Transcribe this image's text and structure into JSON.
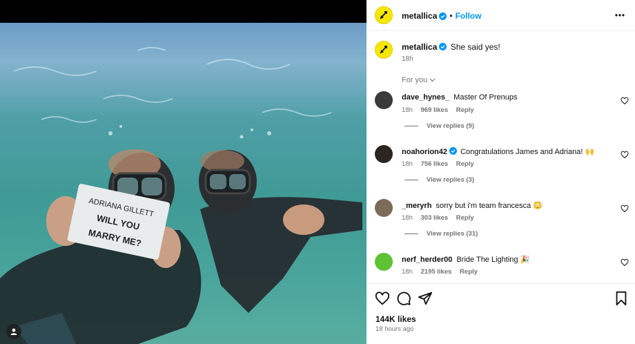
{
  "post": {
    "username": "metallica",
    "follow_label": "Follow",
    "caption": "She said yes!",
    "caption_time": "18h",
    "sort_label": "For you",
    "likes_total": "144K likes",
    "posted_ago": "18 hours ago",
    "sign_text": {
      "line1": "ADRIANA GILLETT",
      "line2": "WILL YOU",
      "line3": "MARRY ME?"
    }
  },
  "comments": [
    {
      "username": "dave_hynes_",
      "verified": false,
      "text": "Master Of Prenups",
      "time": "18h",
      "likes": "969 likes",
      "reply": "Reply",
      "view_replies": "View replies (9)",
      "avatar_color": "#3a3a3a"
    },
    {
      "username": "noahorion42",
      "verified": true,
      "text": "Congratulations James and Adriana! 🙌",
      "time": "18h",
      "likes": "756 likes",
      "reply": "Reply",
      "view_replies": "View replies (3)",
      "avatar_color": "#2b2420"
    },
    {
      "username": "_meryrh",
      "verified": false,
      "text": "sorry but i'm team francesca 😳",
      "time": "18h",
      "likes": "303 likes",
      "reply": "Reply",
      "view_replies": "View replies (31)",
      "avatar_color": "#7d6a58"
    },
    {
      "username": "nerf_herder00",
      "verified": false,
      "text": "Bride The Lighting 🎉",
      "time": "18h",
      "likes": "2195 likes",
      "reply": "Reply",
      "view_replies": "",
      "avatar_color": "#5fc234"
    }
  ],
  "colors": {
    "accent": "#0095f6",
    "brand_avatar": "#f7e600",
    "verified": "#0095f6"
  },
  "icons": {
    "header": [
      "verified-icon",
      "more-options-icon"
    ],
    "actions": [
      "heart-icon",
      "comment-icon",
      "share-icon",
      "bookmark-icon"
    ],
    "media": [
      "user-tag-icon"
    ]
  }
}
